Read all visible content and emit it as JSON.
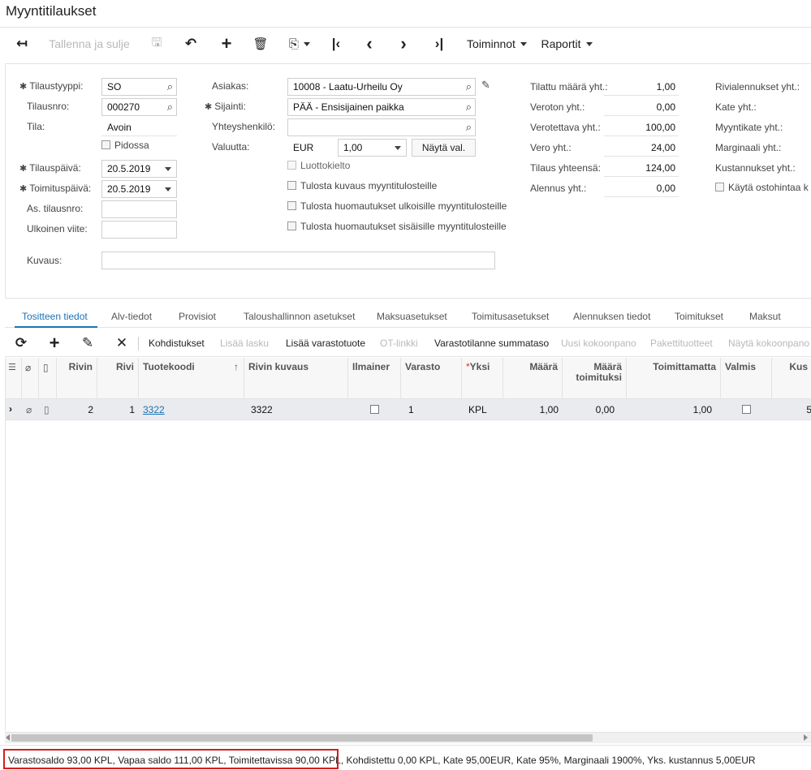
{
  "page": {
    "title": "Myyntitilaukset"
  },
  "toolbar": {
    "back": "↤",
    "save_close": "Tallenna ja sulje",
    "save": "🖫",
    "undo": "↶",
    "add": "+",
    "delete": "🗑",
    "copy": "⎘",
    "first": "|‹",
    "prev": "‹",
    "next": "›",
    "last": "›|",
    "actions": "Toiminnot",
    "reports": "Raportit"
  },
  "form": {
    "order_type": {
      "label": "Tilaustyyppi:",
      "value": "SO"
    },
    "order_nbr": {
      "label": "Tilausnro:",
      "value": "000270"
    },
    "status": {
      "label": "Tila:",
      "value": "Avoin"
    },
    "hold": {
      "label": "Pidossa"
    },
    "order_date": {
      "label": "Tilauspäivä:",
      "value": "20.5.2019"
    },
    "ship_date": {
      "label": "Toimituspäivä:",
      "value": "20.5.2019"
    },
    "cust_order": {
      "label": "As. tilausnro:",
      "value": ""
    },
    "ext_ref": {
      "label": "Ulkoinen viite:",
      "value": ""
    },
    "description": {
      "label": "Kuvaus:",
      "value": ""
    },
    "customer": {
      "label": "Asiakas:",
      "value": "10008 - Laatu-Urheilu Oy"
    },
    "location": {
      "label": "Sijainti:",
      "value": "PÄÄ - Ensisijainen paikka"
    },
    "contact": {
      "label": "Yhteyshenkilö:",
      "value": ""
    },
    "currency": {
      "label": "Valuutta:",
      "value": "EUR",
      "rate": "1,00",
      "button": "Näytä val."
    },
    "credit_hold": "Luottokielto",
    "print_desc": "Tulosta kuvaus myyntitulosteille",
    "print_ext_notes": "Tulosta huomautukset ulkoisille myyntitulosteille",
    "print_int_notes": "Tulosta huomautukset sisäisille myyntitulosteille",
    "totals": [
      {
        "label": "Tilattu määrä yht.:",
        "value": "1,00"
      },
      {
        "label": "Veroton yht.:",
        "value": "0,00"
      },
      {
        "label": "Verotettava yht.:",
        "value": "100,00"
      },
      {
        "label": "Vero yht.:",
        "value": "24,00"
      },
      {
        "label": "Tilaus yhteensä:",
        "value": "124,00"
      },
      {
        "label": "Alennus yht.:",
        "value": "0,00"
      }
    ],
    "totals2": [
      "Rivialennukset yht.:",
      "Kate yht.:",
      "Myyntikate yht.:",
      "Marginaali yht.:",
      "Kustannukset yht.:"
    ],
    "use_purchase_price": "Käytä ostohintaa k"
  },
  "tabs": [
    "Tositteen tiedot",
    "Alv-tiedot",
    "Provisiot",
    "Taloushallinnon asetukset",
    "Maksuasetukset",
    "Toimitusasetukset",
    "Alennuksen tiedot",
    "Toimitukset",
    "Maksut"
  ],
  "grid_toolbar": {
    "refresh": "⟳",
    "add": "+",
    "edit": "✎",
    "delete": "✕",
    "allocations": "Kohdistukset",
    "add_invoice": "Lisää lasku",
    "add_stock_item": "Lisää varastotuote",
    "ot_links": "OT-linkki",
    "inventory_summary": "Varastotilanne summataso",
    "new_kit": "Uusi kokoonpano",
    "package_items": "Pakettituotteet",
    "show_kit": "Näytä kokoonpano"
  },
  "grid": {
    "headers": {
      "line_nbr": "Rivin",
      "line": "Rivi",
      "item": "Tuotekoodi",
      "sort_arrow": "↑",
      "line_desc": "Rivin kuvaus",
      "free": "Ilmainer",
      "warehouse": "Varasto",
      "uom": "Yksi",
      "qty": "Määrä",
      "qty_shipped_1": "Määrä",
      "qty_shipped_2": "toimituksi",
      "open_qty": "Toimittamatta",
      "completed": "Valmis",
      "cost": "Kus"
    },
    "row": {
      "line_nbr": "2",
      "line": "1",
      "item": "3322",
      "line_desc": "3322",
      "warehouse": "1",
      "uom": "KPL",
      "qty": "1,00",
      "qty_shipped": "0,00",
      "open_qty": "1,00",
      "cost": "5"
    }
  },
  "statusbar": {
    "text": "Varastosaldo 93,00 KPL, Vapaa saldo 111,00 KPL, Toimitettavissa 90,00 KPL, Kohdistettu 0,00 KPL, Kate 95,00EUR, Kate 95%, Marginaali 1900%, Yks. kustannus 5,00EUR"
  },
  "colors": {
    "accent": "#1a73b8",
    "highlight": "#d21f1f",
    "row_bg": "#e9ebee"
  }
}
